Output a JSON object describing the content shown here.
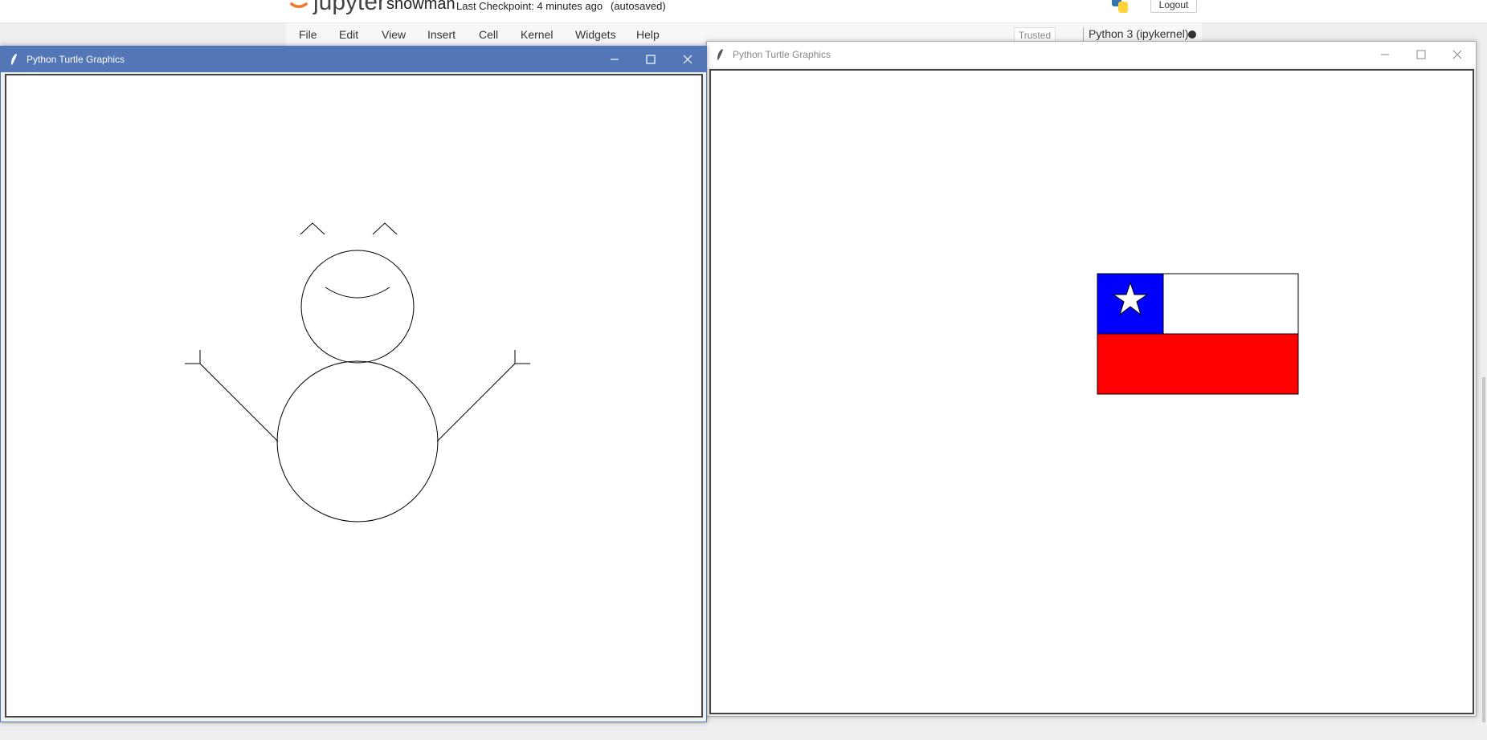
{
  "jupyter": {
    "logo_text": "jupyter",
    "notebook_name": "snowman",
    "checkpoint": "Last Checkpoint: 4 minutes ago",
    "autosave": "(autosaved)",
    "logout_label": "Logout",
    "menu": [
      "File",
      "Edit",
      "View",
      "Insert",
      "Cell",
      "Kernel",
      "Widgets",
      "Help"
    ],
    "trusted_label": "Trusted",
    "kernel_label": "Python 3 (ipykernel)"
  },
  "windows": [
    {
      "title": "Python Turtle Graphics",
      "active": true,
      "drawing": "snowman"
    },
    {
      "title": "Python Turtle Graphics",
      "active": false,
      "drawing": "chile-flag"
    }
  ],
  "colors": {
    "active_titlebar": "#5276b6",
    "flag_blue": "#0000ff",
    "flag_red": "#ff0000",
    "flag_white": "#ffffff"
  },
  "icons": {
    "window": [
      "feather-icon",
      "minimize-icon",
      "maximize-icon",
      "close-icon"
    ]
  }
}
